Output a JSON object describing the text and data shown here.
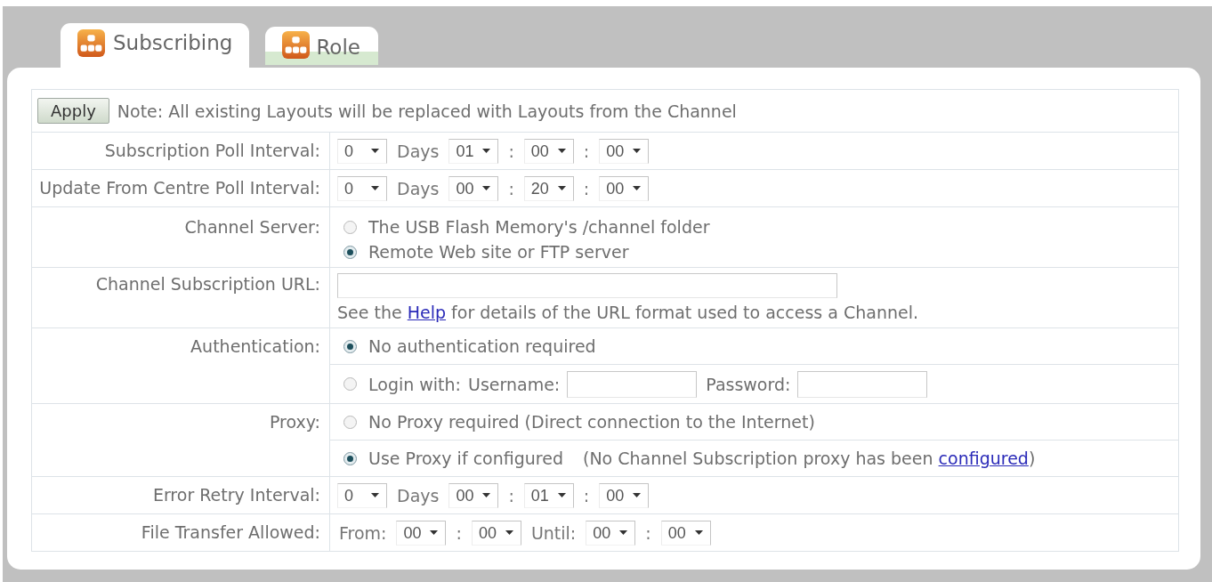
{
  "tabs": [
    {
      "label": "Subscribing",
      "selected": true
    },
    {
      "label": "Role",
      "selected": false
    }
  ],
  "apply_row": {
    "button": "Apply",
    "note": "Note: All existing Layouts will be replaced with Layouts from the Channel"
  },
  "rows": [
    {
      "kind": "interval",
      "label": "Subscription Poll Interval:",
      "parts": [
        {
          "kind": "select",
          "value": "0"
        },
        {
          "kind": "text",
          "text": "Days"
        },
        {
          "kind": "select",
          "value": "01"
        },
        {
          "kind": "text",
          "text": ":"
        },
        {
          "kind": "select",
          "value": "00"
        },
        {
          "kind": "text",
          "text": ":"
        },
        {
          "kind": "select",
          "value": "00"
        }
      ]
    },
    {
      "kind": "interval",
      "label": "Update From Centre Poll Interval:",
      "parts": [
        {
          "kind": "select",
          "value": "0"
        },
        {
          "kind": "text",
          "text": "Days"
        },
        {
          "kind": "select",
          "value": "00"
        },
        {
          "kind": "text",
          "text": ":"
        },
        {
          "kind": "select",
          "value": "20"
        },
        {
          "kind": "text",
          "text": ":"
        },
        {
          "kind": "select",
          "value": "00"
        }
      ]
    },
    {
      "kind": "radios",
      "label": "Channel Server:",
      "options": [
        {
          "label": "The USB Flash Memory's /channel folder",
          "selected": false
        },
        {
          "label": "Remote Web site or FTP server",
          "selected": true
        }
      ]
    },
    {
      "kind": "url",
      "label": "Channel Subscription URL:",
      "help_before": "See the",
      "help_link": "Help",
      "help_after": "for details of the URL format used to access a Channel."
    },
    {
      "kind": "radio_rows",
      "label": "Authentication:",
      "options": [
        {
          "label": "No authentication required",
          "selected": true
        },
        {
          "label": "Login with:",
          "selected": false,
          "fields": [
            {
              "label": "Username:"
            },
            {
              "label": "Password:"
            }
          ]
        }
      ]
    },
    {
      "kind": "radio_rows",
      "label": "Proxy:",
      "options": [
        {
          "label": "No Proxy required (Direct connection to the Internet)",
          "selected": false
        },
        {
          "label": "Use Proxy if configured",
          "selected": true,
          "note_before": "(No Channel Subscription proxy has been",
          "note_link": "configured",
          "note_after": ")"
        }
      ]
    },
    {
      "kind": "interval",
      "label": "Error Retry Interval:",
      "parts": [
        {
          "kind": "select",
          "value": "0"
        },
        {
          "kind": "text",
          "text": "Days"
        },
        {
          "kind": "select",
          "value": "00"
        },
        {
          "kind": "text",
          "text": ":"
        },
        {
          "kind": "select",
          "value": "01"
        },
        {
          "kind": "text",
          "text": ":"
        },
        {
          "kind": "select",
          "value": "00"
        }
      ]
    },
    {
      "kind": "interval",
      "label": "File Transfer Allowed:",
      "parts": [
        {
          "kind": "text",
          "text": "From:"
        },
        {
          "kind": "select",
          "value": "00"
        },
        {
          "kind": "text",
          "text": ":"
        },
        {
          "kind": "select",
          "value": "00"
        },
        {
          "kind": "text",
          "text": "Until:"
        },
        {
          "kind": "select",
          "value": "00"
        },
        {
          "kind": "text",
          "text": ":"
        },
        {
          "kind": "select",
          "value": "00"
        }
      ]
    }
  ]
}
